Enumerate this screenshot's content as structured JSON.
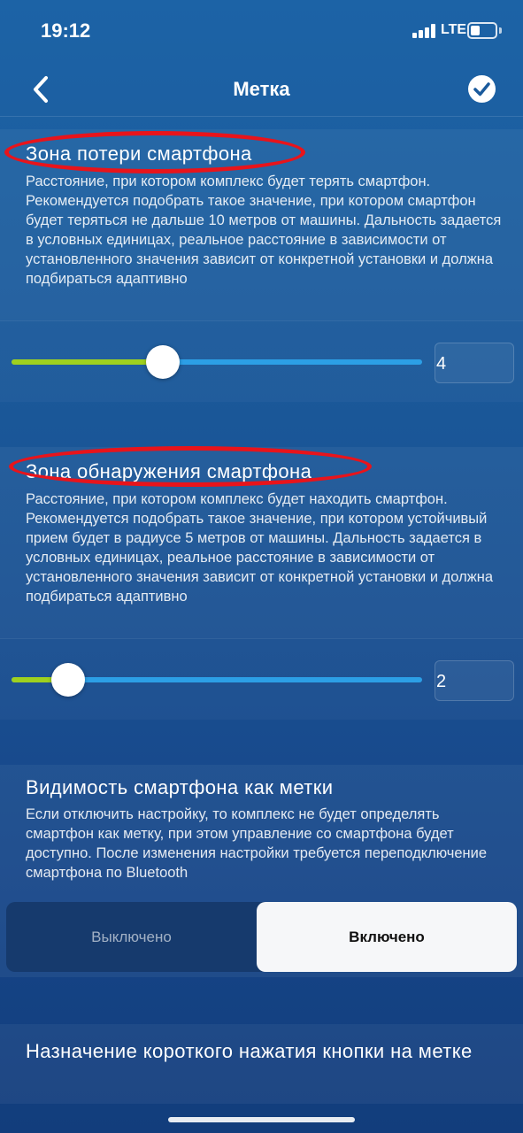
{
  "status_bar": {
    "time": "19:12",
    "network": "LTE"
  },
  "nav": {
    "title": "Метка"
  },
  "loss_zone": {
    "title": "Зона потери смартфона",
    "description": "Расстояние, при котором комплекс будет терять смартфон. Рекомендуется подобрать такое значение, при котором смартфон будет теряться не дальше 10 метров от машины. Дальность задается в условных единицах, реальное расстояние в зависимости от установленного значения зависит от конкретной установки и должна подбираться адаптивно",
    "value": "4"
  },
  "detection_zone": {
    "title": "Зона обнаружения смартфона",
    "description": "Расстояние, при котором комплекс будет находить смартфон. Рекомендуется подобрать такое значение, при котором устойчивый прием будет в радиусе 5 метров от машины. Дальность задается в условных единицах, реальное расстояние в зависимости от установленного значения зависит от конкретной установки и должна подбираться адаптивно",
    "value": "2"
  },
  "visibility": {
    "title": "Видимость смартфона как метки",
    "description": "Если отключить настройку, то комплекс не будет определять смартфон как метку, при этом управление со смартфона будет доступно. После изменения настройки требуется переподключение смартфона по Bluetooth",
    "off_label": "Выключено",
    "on_label": "Включено",
    "selected": "Включено"
  },
  "short_press": {
    "title": "Назначение короткого нажатия кнопки на метке"
  },
  "colors": {
    "slider_fill": "#9fd11f",
    "slider_track": "#2c9fe6",
    "highlight": "#e8141b"
  }
}
